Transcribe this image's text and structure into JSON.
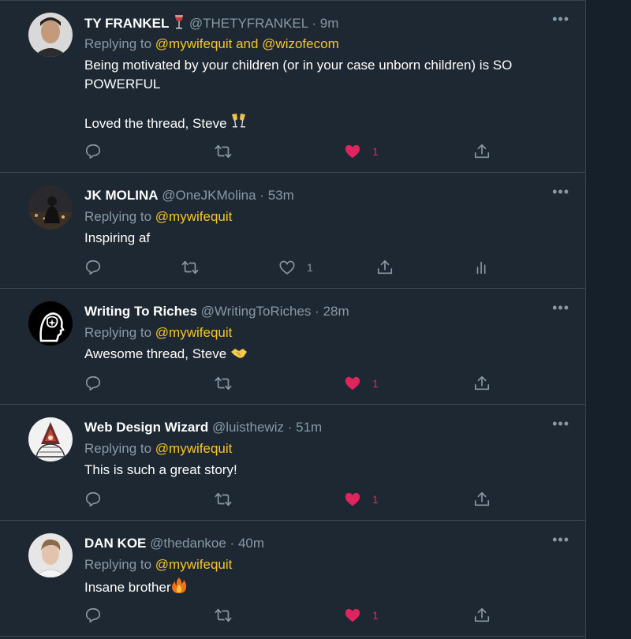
{
  "colors": {
    "accent": "#f7c52a",
    "like": "#e0245e",
    "muted": "#8899a6",
    "background": "#1e2833"
  },
  "tweets": [
    {
      "name": "TY FRANKEL",
      "name_emoji": "wine-glass-icon",
      "handle": "@THETYFRANKEL",
      "sep": "·",
      "time": "9m",
      "replying_prefix": "Replying to",
      "mentions": "@mywifequit and @wizofecom",
      "body_line1": "Being motivated by your children (or in your case unborn children) is SO POWERFUL",
      "body_line2": "Loved the thread, Steve",
      "body_emoji": "clinking-glasses-icon",
      "likes": "1",
      "liked": true
    },
    {
      "name": "JK MOLINA",
      "handle": "@OneJKMolina",
      "sep": "·",
      "time": "53m",
      "replying_prefix": "Replying to",
      "mentions": "@mywifequit",
      "body_line1": "Inspiring af",
      "likes": "1",
      "liked": false,
      "extra_icon": "analytics-icon"
    },
    {
      "name": "Writing To Riches",
      "handle": "@WritingToRiches",
      "sep": "·",
      "time": "28m",
      "replying_prefix": "Replying to",
      "mentions": "@mywifequit",
      "body_line1": "Awesome thread, Steve",
      "body_emoji": "handshake-icon",
      "likes": "1",
      "liked": true
    },
    {
      "name": "Web Design Wizard",
      "handle": "@luisthewiz",
      "sep": "·",
      "time": "51m",
      "replying_prefix": "Replying to",
      "mentions": "@mywifequit",
      "body_line1": "This is such a great story!",
      "likes": "1",
      "liked": true
    },
    {
      "name": "DAN KOE",
      "handle": "@thedankoe",
      "sep": "·",
      "time": "40m",
      "replying_prefix": "Replying to",
      "mentions": "@mywifequit",
      "body_line1": "Insane brother",
      "body_emoji": "fire-icon",
      "likes": "1",
      "liked": true
    }
  ],
  "more_label": "•••"
}
